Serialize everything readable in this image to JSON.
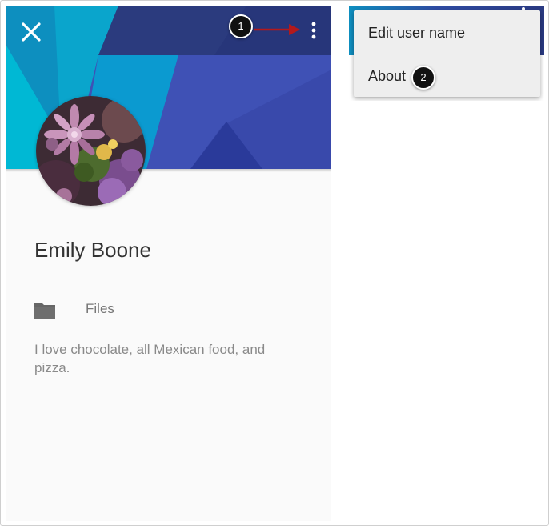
{
  "profile": {
    "name": "Emily Boone",
    "files_label": "Files",
    "bio": "I love chocolate, all Mexican food, and pizza."
  },
  "icons": {
    "close": "close-icon",
    "more": "more-vert-icon",
    "folder": "folder-icon"
  },
  "menu": {
    "items": [
      {
        "label": "Edit user name"
      },
      {
        "label": "About"
      }
    ]
  },
  "callouts": [
    "1",
    "2"
  ],
  "colors": {
    "header_dark": "#2b3b7e",
    "header_mid": "#3f51b5",
    "header_cyan": "#00b4d8",
    "arrow": "#b3191b",
    "text_primary": "#333333",
    "text_secondary": "#8a8a8a"
  }
}
